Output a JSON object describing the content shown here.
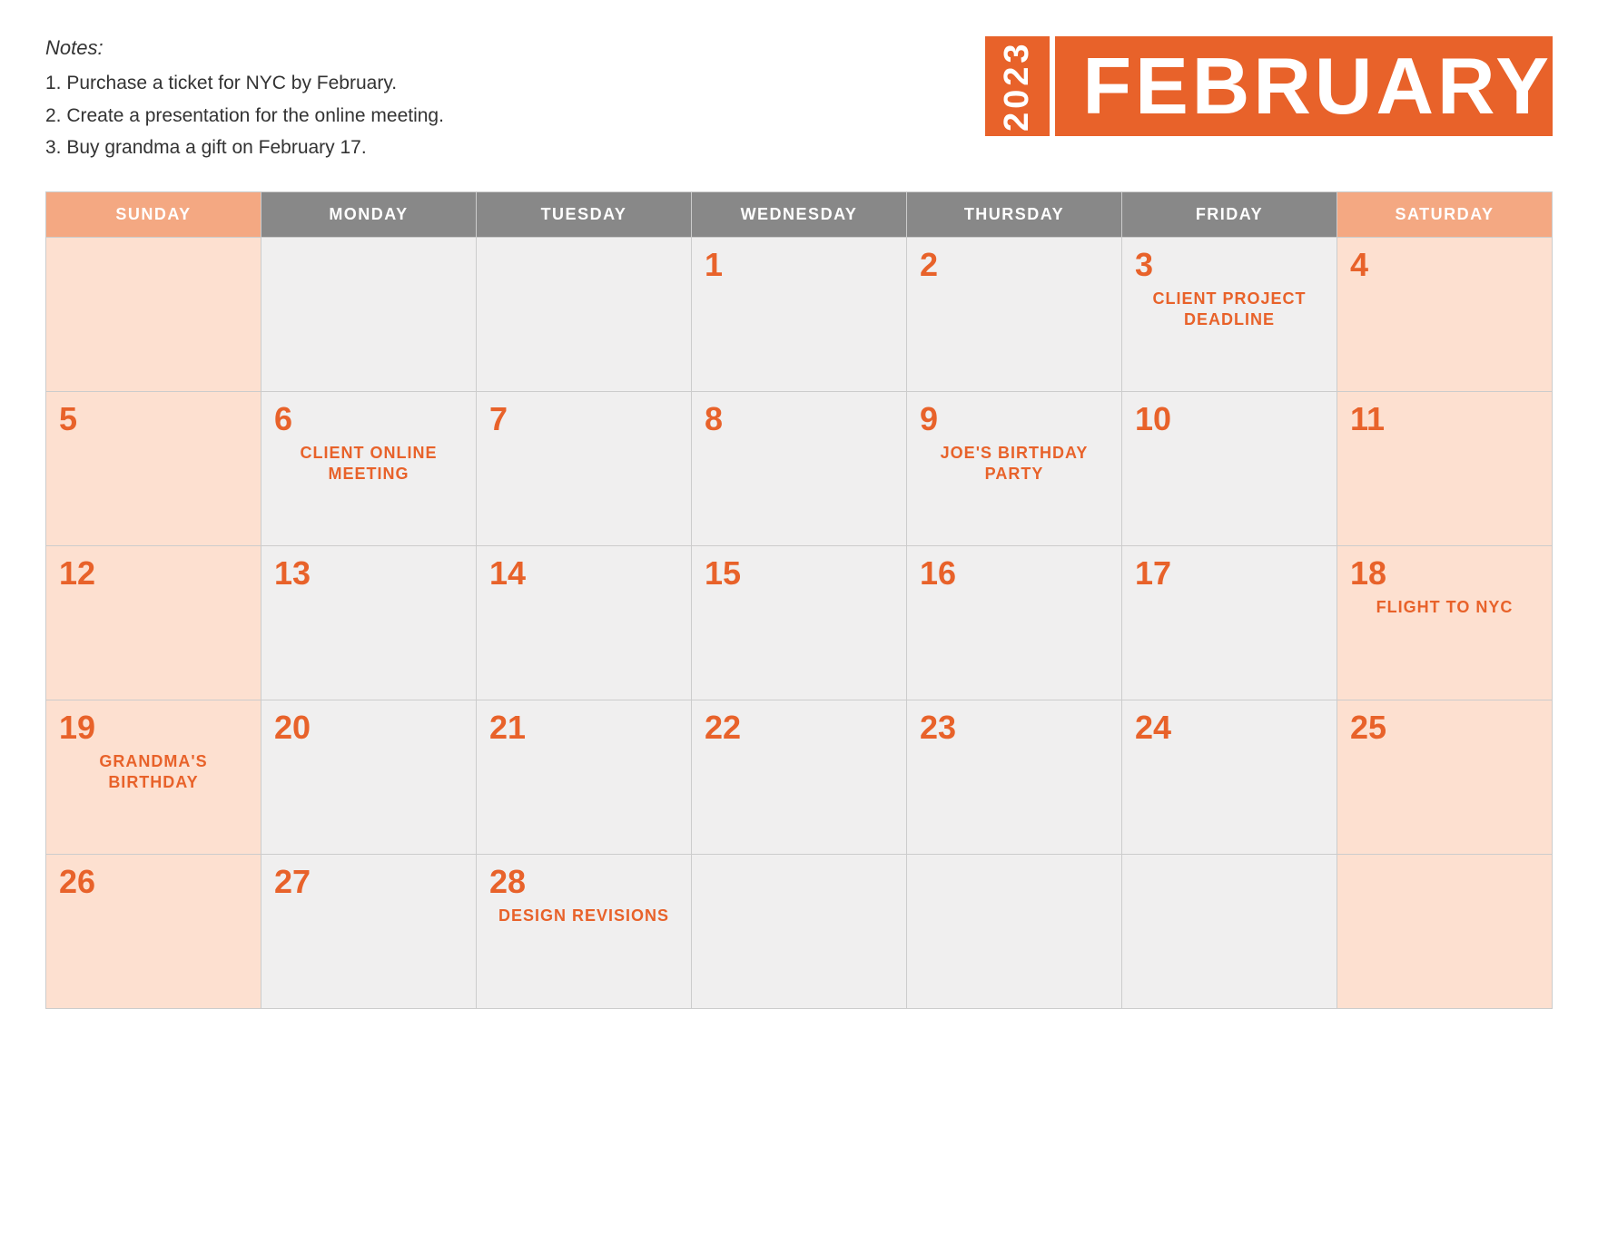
{
  "notes": {
    "title": "Notes:",
    "items": [
      "1. Purchase a ticket for NYC by February.",
      "2. Create a presentation for the online meeting.",
      "3. Buy grandma a gift on February 17."
    ]
  },
  "header": {
    "year": "2023",
    "month": "FEBRUARY"
  },
  "weekdays": [
    "SUNDAY",
    "MONDAY",
    "TUESDAY",
    "WEDNESDAY",
    "THURSDAY",
    "FRIDAY",
    "SATURDAY"
  ],
  "weeks": [
    [
      {
        "day": "",
        "event": "",
        "type": "empty-weekend"
      },
      {
        "day": "",
        "event": "",
        "type": "empty"
      },
      {
        "day": "",
        "event": "",
        "type": "empty"
      },
      {
        "day": "1",
        "event": "",
        "type": "weekday"
      },
      {
        "day": "2",
        "event": "",
        "type": "weekday"
      },
      {
        "day": "3",
        "event": "CLIENT PROJECT DEADLINE",
        "type": "weekday"
      },
      {
        "day": "4",
        "event": "",
        "type": "weekend"
      }
    ],
    [
      {
        "day": "5",
        "event": "",
        "type": "weekend"
      },
      {
        "day": "6",
        "event": "CLIENT ONLINE MEETING",
        "type": "weekday"
      },
      {
        "day": "7",
        "event": "",
        "type": "weekday"
      },
      {
        "day": "8",
        "event": "",
        "type": "weekday"
      },
      {
        "day": "9",
        "event": "JOE'S BIRTHDAY PARTY",
        "type": "weekday"
      },
      {
        "day": "10",
        "event": "",
        "type": "weekday"
      },
      {
        "day": "11",
        "event": "",
        "type": "weekend"
      }
    ],
    [
      {
        "day": "12",
        "event": "",
        "type": "weekend"
      },
      {
        "day": "13",
        "event": "",
        "type": "weekday"
      },
      {
        "day": "14",
        "event": "",
        "type": "weekday"
      },
      {
        "day": "15",
        "event": "",
        "type": "weekday"
      },
      {
        "day": "16",
        "event": "",
        "type": "weekday"
      },
      {
        "day": "17",
        "event": "",
        "type": "weekday"
      },
      {
        "day": "18",
        "event": "FLIGHT TO NYC",
        "type": "weekend"
      }
    ],
    [
      {
        "day": "19",
        "event": "GRANDMA'S BIRTHDAY",
        "type": "weekend"
      },
      {
        "day": "20",
        "event": "",
        "type": "weekday"
      },
      {
        "day": "21",
        "event": "",
        "type": "weekday"
      },
      {
        "day": "22",
        "event": "",
        "type": "weekday"
      },
      {
        "day": "23",
        "event": "",
        "type": "weekday"
      },
      {
        "day": "24",
        "event": "",
        "type": "weekday"
      },
      {
        "day": "25",
        "event": "",
        "type": "weekend"
      }
    ],
    [
      {
        "day": "26",
        "event": "",
        "type": "weekend"
      },
      {
        "day": "27",
        "event": "",
        "type": "weekday"
      },
      {
        "day": "28",
        "event": "DESIGN REVISIONS",
        "type": "weekday"
      },
      {
        "day": "",
        "event": "",
        "type": "empty"
      },
      {
        "day": "",
        "event": "",
        "type": "empty"
      },
      {
        "day": "",
        "event": "",
        "type": "empty"
      },
      {
        "day": "",
        "event": "",
        "type": "empty-weekend"
      }
    ]
  ]
}
